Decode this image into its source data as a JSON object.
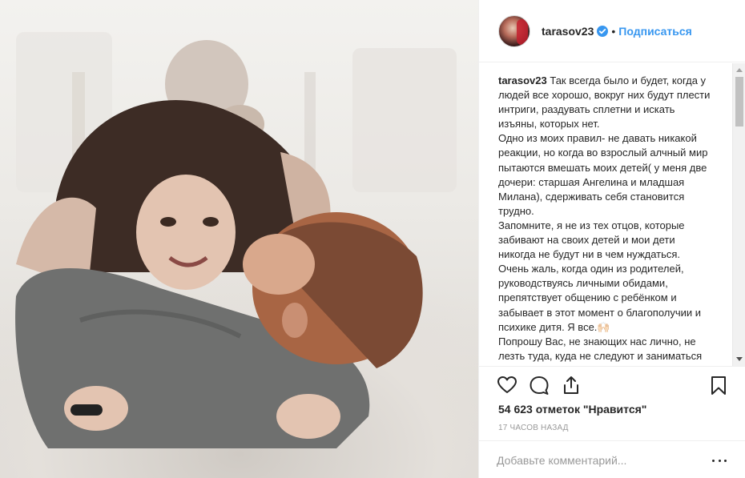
{
  "post": {
    "photo_alt": "Фото",
    "author": {
      "username": "tarasov23",
      "follow_label": "Подписаться",
      "dot": "•"
    },
    "caption": {
      "username": "tarasov23",
      "text": "Так всегда было и будет, когда у людей все хорошо, вокруг них будут плести интриги, раздувать сплетни и искать изъяны, которых нет.\nОдно из моих правил- не давать никакой реакции, но когда во взрослый алчный мир пытаются вмешать моих детей( у меня две дочери: старшая Ангелина и младшая Милана), сдерживать себя становится трудно.\nЗапомните, я не из тех отцов, которые забивают на своих детей и мои дети никогда не будут ни в чем нуждаться.\nОчень жаль, когда один из родителей, руководствуясь личными обидами, препятствует общению с ребёнком и забывает в этот момент о благополучии и психике дитя. Я все.🙌🏻\nПопрошу Вас, не знающих нас лично, не лезть туда, куда не следуют и заниматься своими делами."
    },
    "likes_label": "54 623 отметок \"Нравится\"",
    "timestamp": "17 часов назад",
    "comment_placeholder": "Добавьте комментарий..."
  },
  "icons": {
    "like": "heart-icon",
    "comment": "comment-icon",
    "share": "share-icon",
    "save": "bookmark-icon",
    "verified": "verified-badge-icon",
    "more": "more-options-icon"
  },
  "colors": {
    "link": "#3897f0",
    "text": "#262626",
    "muted": "#999999",
    "border": "#efefef"
  }
}
